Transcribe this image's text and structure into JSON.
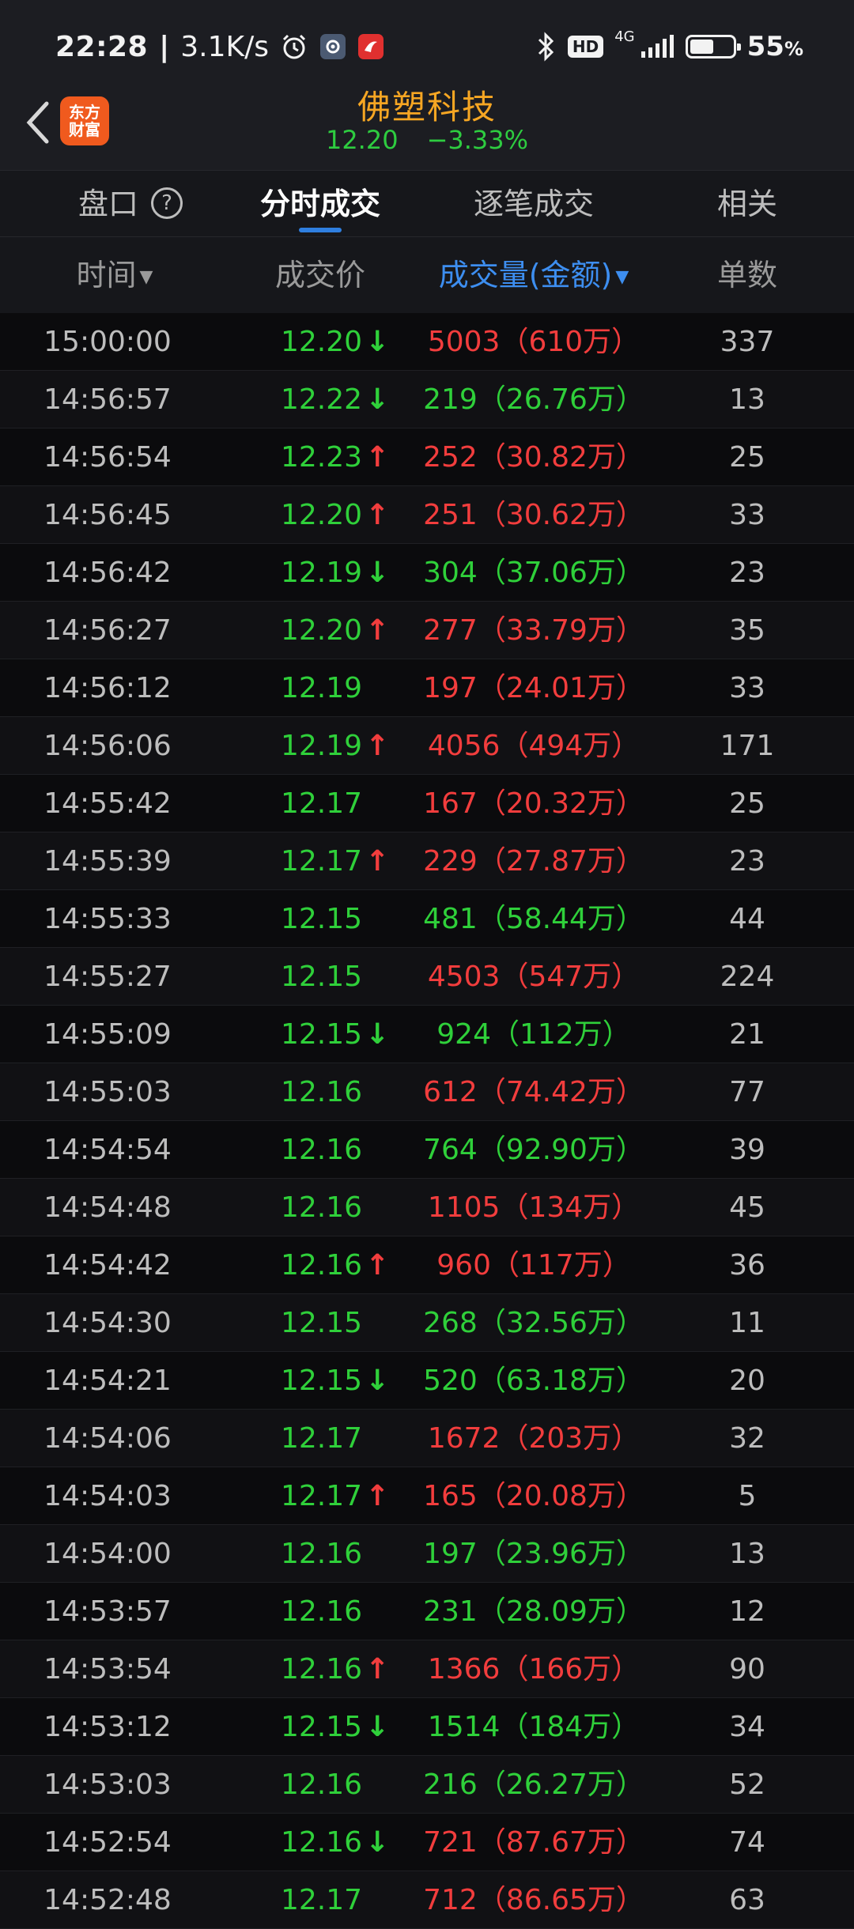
{
  "status_bar": {
    "time": "22:28",
    "network_speed": "3.1K/s",
    "hd_badge": "HD",
    "network_type": "4G",
    "battery_percent": "55",
    "battery_unit": "%",
    "battery_level": 0.55,
    "icons": [
      "alarm-icon",
      "settings-app-icon",
      "app-notification-icon",
      "bluetooth-icon",
      "hd-icon",
      "signal-icon",
      "battery-icon"
    ]
  },
  "header": {
    "app_logo_line1": "东方",
    "app_logo_line2": "财富",
    "stock_name": "佛塑科技",
    "price": "12.20",
    "change_pct": "−3.33%"
  },
  "tabs": [
    {
      "label": "盘口",
      "active": false
    },
    {
      "label": "分时成交",
      "active": true
    },
    {
      "label": "逐笔成交",
      "active": false
    },
    {
      "label": "相关",
      "active": false
    }
  ],
  "columns": {
    "time": "时间",
    "price": "成交价",
    "volume": "成交量(金额)",
    "count": "单数"
  },
  "colors": {
    "up_red": "#f23d3d",
    "down_green": "#2fd03a",
    "accent_blue": "#3d8ef0",
    "stock_name_orange": "#f6a623"
  },
  "trades": [
    {
      "time": "15:00:00",
      "price": "12.20",
      "arrow": "down",
      "volume": "5003",
      "amount": "610万",
      "vol_color": "red",
      "count": "337"
    },
    {
      "time": "14:56:57",
      "price": "12.22",
      "arrow": "down",
      "volume": "219",
      "amount": "26.76万",
      "vol_color": "green",
      "count": "13"
    },
    {
      "time": "14:56:54",
      "price": "12.23",
      "arrow": "up",
      "volume": "252",
      "amount": "30.82万",
      "vol_color": "red",
      "count": "25"
    },
    {
      "time": "14:56:45",
      "price": "12.20",
      "arrow": "up",
      "volume": "251",
      "amount": "30.62万",
      "vol_color": "red",
      "count": "33"
    },
    {
      "time": "14:56:42",
      "price": "12.19",
      "arrow": "down",
      "volume": "304",
      "amount": "37.06万",
      "vol_color": "green",
      "count": "23"
    },
    {
      "time": "14:56:27",
      "price": "12.20",
      "arrow": "up",
      "volume": "277",
      "amount": "33.79万",
      "vol_color": "red",
      "count": "35"
    },
    {
      "time": "14:56:12",
      "price": "12.19",
      "arrow": "",
      "volume": "197",
      "amount": "24.01万",
      "vol_color": "red",
      "count": "33"
    },
    {
      "time": "14:56:06",
      "price": "12.19",
      "arrow": "up",
      "volume": "4056",
      "amount": "494万",
      "vol_color": "red",
      "count": "171"
    },
    {
      "time": "14:55:42",
      "price": "12.17",
      "arrow": "",
      "volume": "167",
      "amount": "20.32万",
      "vol_color": "red",
      "count": "25"
    },
    {
      "time": "14:55:39",
      "price": "12.17",
      "arrow": "up",
      "volume": "229",
      "amount": "27.87万",
      "vol_color": "red",
      "count": "23"
    },
    {
      "time": "14:55:33",
      "price": "12.15",
      "arrow": "",
      "volume": "481",
      "amount": "58.44万",
      "vol_color": "green",
      "count": "44"
    },
    {
      "time": "14:55:27",
      "price": "12.15",
      "arrow": "",
      "volume": "4503",
      "amount": "547万",
      "vol_color": "red",
      "count": "224"
    },
    {
      "time": "14:55:09",
      "price": "12.15",
      "arrow": "down",
      "volume": "924",
      "amount": "112万",
      "vol_color": "green",
      "count": "21"
    },
    {
      "time": "14:55:03",
      "price": "12.16",
      "arrow": "",
      "volume": "612",
      "amount": "74.42万",
      "vol_color": "red",
      "count": "77"
    },
    {
      "time": "14:54:54",
      "price": "12.16",
      "arrow": "",
      "volume": "764",
      "amount": "92.90万",
      "vol_color": "green",
      "count": "39"
    },
    {
      "time": "14:54:48",
      "price": "12.16",
      "arrow": "",
      "volume": "1105",
      "amount": "134万",
      "vol_color": "red",
      "count": "45"
    },
    {
      "time": "14:54:42",
      "price": "12.16",
      "arrow": "up",
      "volume": "960",
      "amount": "117万",
      "vol_color": "red",
      "count": "36"
    },
    {
      "time": "14:54:30",
      "price": "12.15",
      "arrow": "",
      "volume": "268",
      "amount": "32.56万",
      "vol_color": "green",
      "count": "11"
    },
    {
      "time": "14:54:21",
      "price": "12.15",
      "arrow": "down",
      "volume": "520",
      "amount": "63.18万",
      "vol_color": "green",
      "count": "20"
    },
    {
      "time": "14:54:06",
      "price": "12.17",
      "arrow": "",
      "volume": "1672",
      "amount": "203万",
      "vol_color": "red",
      "count": "32"
    },
    {
      "time": "14:54:03",
      "price": "12.17",
      "arrow": "up",
      "volume": "165",
      "amount": "20.08万",
      "vol_color": "red",
      "count": "5"
    },
    {
      "time": "14:54:00",
      "price": "12.16",
      "arrow": "",
      "volume": "197",
      "amount": "23.96万",
      "vol_color": "green",
      "count": "13"
    },
    {
      "time": "14:53:57",
      "price": "12.16",
      "arrow": "",
      "volume": "231",
      "amount": "28.09万",
      "vol_color": "green",
      "count": "12"
    },
    {
      "time": "14:53:54",
      "price": "12.16",
      "arrow": "up",
      "volume": "1366",
      "amount": "166万",
      "vol_color": "red",
      "count": "90"
    },
    {
      "time": "14:53:12",
      "price": "12.15",
      "arrow": "down",
      "volume": "1514",
      "amount": "184万",
      "vol_color": "green",
      "count": "34"
    },
    {
      "time": "14:53:03",
      "price": "12.16",
      "arrow": "",
      "volume": "216",
      "amount": "26.27万",
      "vol_color": "green",
      "count": "52"
    },
    {
      "time": "14:52:54",
      "price": "12.16",
      "arrow": "down",
      "volume": "721",
      "amount": "87.67万",
      "vol_color": "red",
      "count": "74"
    },
    {
      "time": "14:52:48",
      "price": "12.17",
      "arrow": "",
      "volume": "712",
      "amount": "86.65万",
      "vol_color": "red",
      "count": "63"
    }
  ]
}
